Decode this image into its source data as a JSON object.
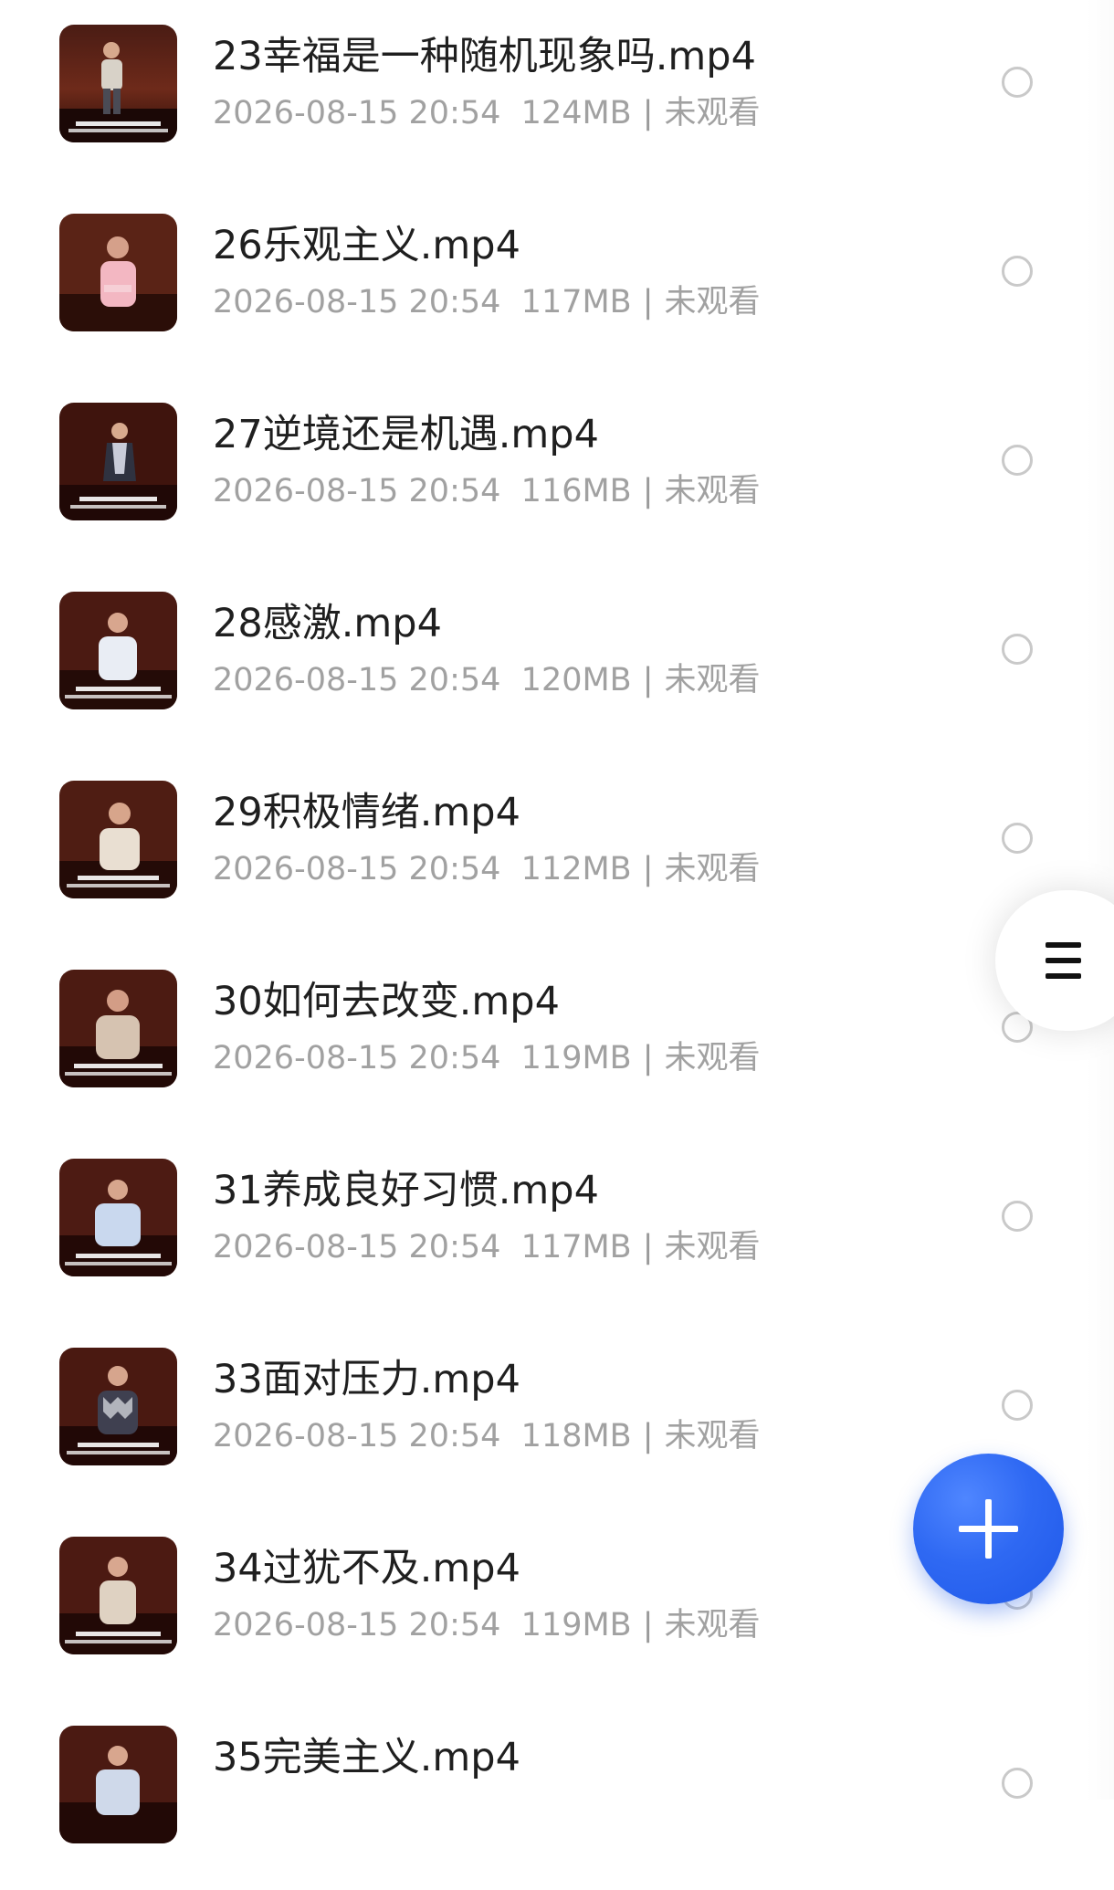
{
  "colors": {
    "background": "#ffffff",
    "title_text": "#1f1f1f",
    "meta_text": "#a1a1a1",
    "radio_border": "#c9c9c9",
    "fab_blue": "#2f69f3"
  },
  "files": [
    {
      "name": "23幸福是一种随机现象吗.mp4",
      "date": "2026-08-15 20:54",
      "size": "124MB",
      "status": "未观看",
      "thumbnail_icon": "video-thumbnail-icon"
    },
    {
      "name": "26乐观主义.mp4",
      "date": "2026-08-15 20:54",
      "size": "117MB",
      "status": "未观看",
      "thumbnail_icon": "video-thumbnail-icon"
    },
    {
      "name": "27逆境还是机遇.mp4",
      "date": "2026-08-15 20:54",
      "size": "116MB",
      "status": "未观看",
      "thumbnail_icon": "video-thumbnail-icon"
    },
    {
      "name": "28感激.mp4",
      "date": "2026-08-15 20:54",
      "size": "120MB",
      "status": "未观看",
      "thumbnail_icon": "video-thumbnail-icon"
    },
    {
      "name": "29积极情绪.mp4",
      "date": "2026-08-15 20:54",
      "size": "112MB",
      "status": "未观看",
      "thumbnail_icon": "video-thumbnail-icon"
    },
    {
      "name": "30如何去改变.mp4",
      "date": "2026-08-15 20:54",
      "size": "119MB",
      "status": "未观看",
      "thumbnail_icon": "video-thumbnail-icon"
    },
    {
      "name": "31养成良好习惯.mp4",
      "date": "2026-08-15 20:54",
      "size": "117MB",
      "status": "未观看",
      "thumbnail_icon": "video-thumbnail-icon"
    },
    {
      "name": "33面对压力.mp4",
      "date": "2026-08-15 20:54",
      "size": "118MB",
      "status": "未观看",
      "thumbnail_icon": "video-thumbnail-icon"
    },
    {
      "name": "34过犹不及.mp4",
      "date": "2026-08-15 20:54",
      "size": "119MB",
      "status": "未观看",
      "thumbnail_icon": "video-thumbnail-icon"
    },
    {
      "name": "35完美主义.mp4",
      "date": "",
      "size": "",
      "status": "",
      "thumbnail_icon": "video-thumbnail-icon"
    }
  ],
  "side_menu": {
    "icon": "menu-icon"
  },
  "fab": {
    "icon": "plus-icon"
  }
}
